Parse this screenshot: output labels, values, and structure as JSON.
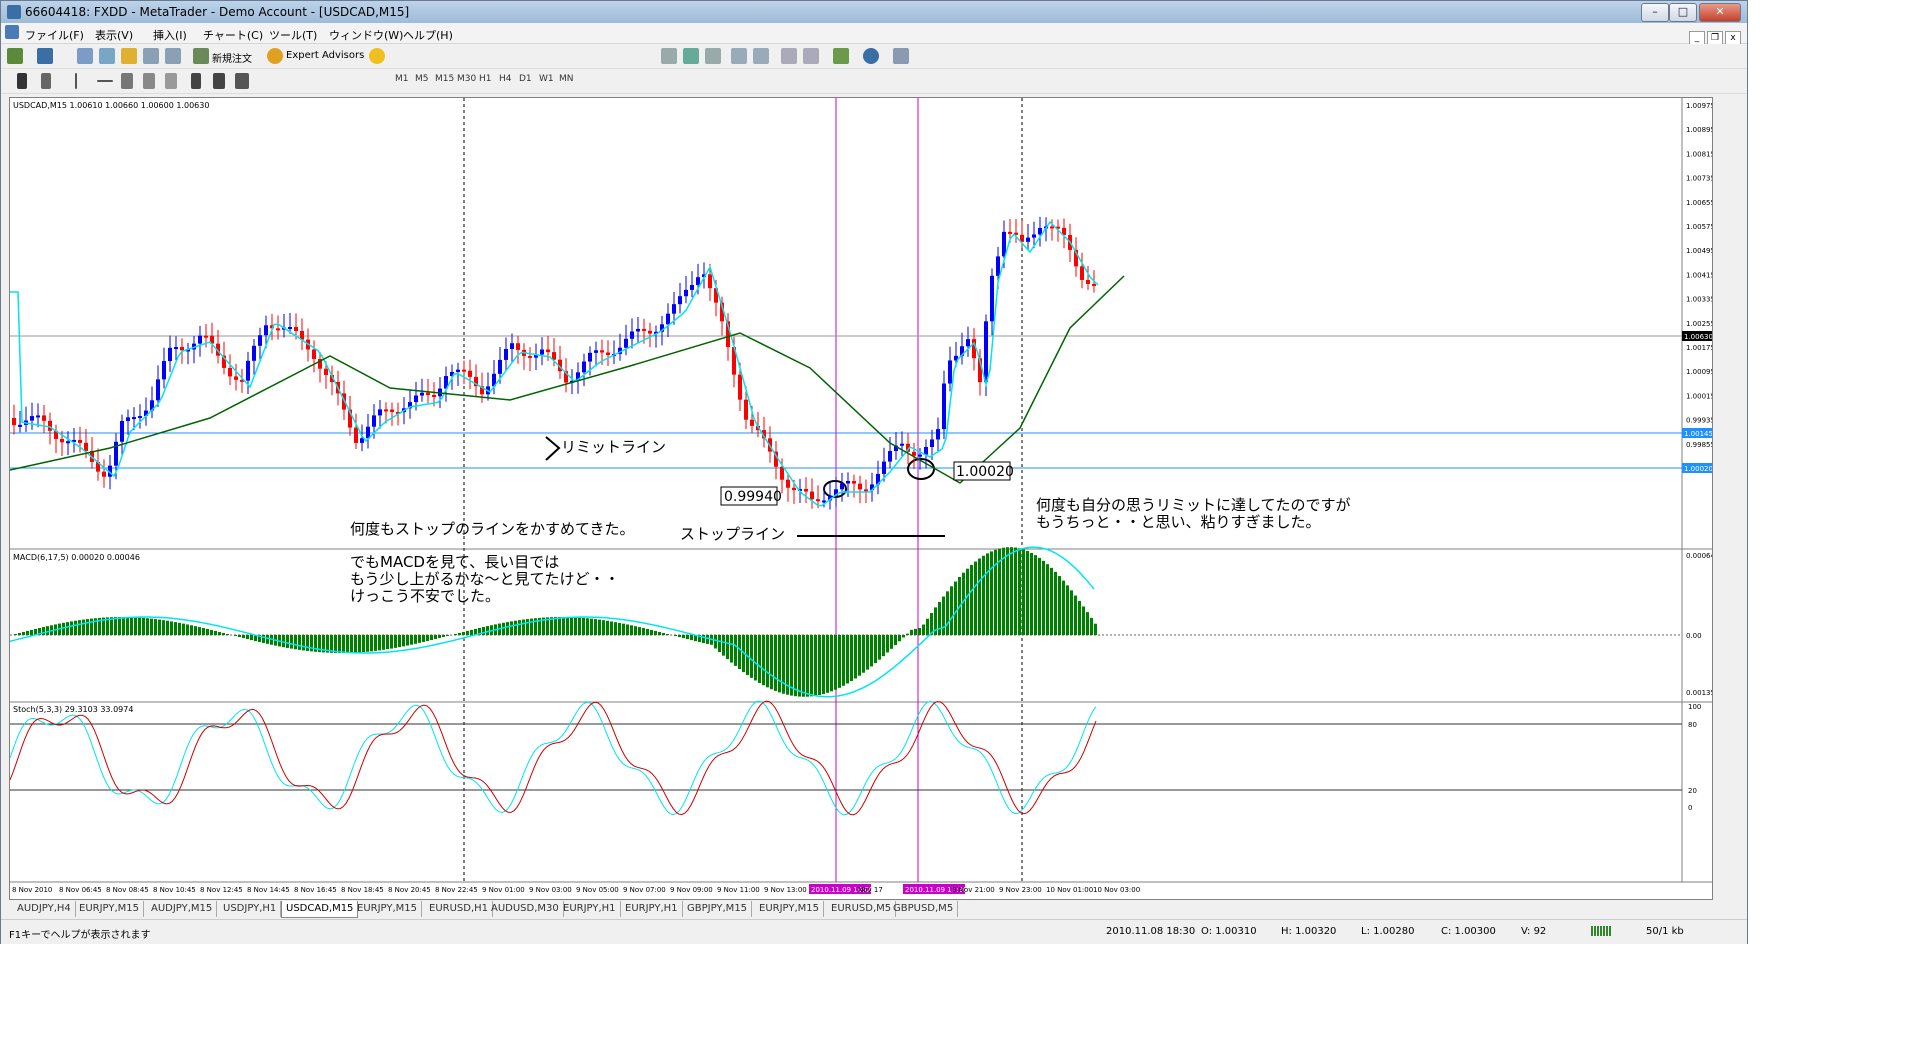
{
  "window": {
    "title": "66604418: FXDD - MetaTrader - Demo Account - [USDCAD,M15]",
    "controls": {
      "minimize": "–",
      "maximize": "□",
      "close": "✕"
    }
  },
  "menu": [
    "ファイル(F)",
    "表示(V)",
    "挿入(I)",
    "チャート(C)",
    "ツール(T)",
    "ウィンドウ(W)",
    "ヘルプ(H)"
  ],
  "toolbar": {
    "new_order": "新規注文",
    "expert_advisors": "Expert Advisors",
    "timeframes": [
      "M1",
      "M5",
      "M15",
      "M30",
      "H1",
      "H4",
      "D1",
      "W1",
      "MN"
    ]
  },
  "chart": {
    "main_info": "USDCAD,M15  1.00610 1.00660 1.00600 1.00630",
    "macd_info": "MACD(6,17,5) 0.00020 0.00046",
    "stoch_info": "Stoch(5,3,3) 29.3103 33.0974",
    "price_ticks": [
      "1.00975",
      "1.00895",
      "1.00815",
      "1.00735",
      "1.00655",
      "1.00575",
      "1.00495",
      "1.00415",
      "1.00335",
      "1.00255",
      "1.00175",
      "1.00095",
      "1.00015",
      "0.99935",
      "0.99855",
      "0.99775"
    ],
    "current_price": "1.00630",
    "limit_price": "1.00145",
    "stop_price": "1.00020",
    "macd_ticks": [
      "0.00064",
      "0.00",
      "0.00135"
    ],
    "stoch_ticks": [
      "100",
      "80",
      "20",
      "0"
    ],
    "time_labels": [
      "8 Nov 2010",
      "8 Nov 06:45",
      "8 Nov 08:45",
      "8 Nov 10:45",
      "8 Nov 12:45",
      "8 Nov 14:45",
      "8 Nov 16:45",
      "8 Nov 18:45",
      "8 Nov 20:45",
      "8 Nov 22:45",
      "9 Nov 01:00",
      "9 Nov 03:00",
      "9 Nov 05:00",
      "9 Nov 07:00",
      "9 Nov 09:00",
      "9 Nov 11:00",
      "9 Nov 13:00",
      "2010.11.09 16:00",
      "Nov 17",
      "2010.11.09 19:30",
      "9 Nov 21:00",
      "9 Nov 23:00",
      "10 Nov 01:00",
      "10 Nov 03:00"
    ],
    "annotations": {
      "limit_line": "リミットライン",
      "box_low": "0.99940",
      "box_stop": "1.00020",
      "stop_line": "ストップライン",
      "note_stop": "何度もストップのラインをかすめてきた。",
      "note_macd": [
        "でもMACDを見て、長い目では",
        "もう少し上がるかな～と見てたけど・・",
        "けっこう不安でした。"
      ],
      "note_right": [
        "何度も自分の思うリミットに達してたのですが",
        "もうちっと・・と思い、粘りすぎました。"
      ]
    }
  },
  "tabs": [
    "AUDJPY,H4",
    "EURJPY,M15",
    "AUDJPY,M15",
    "USDJPY,H1",
    "USDCAD,M15",
    "EURJPY,M15",
    "EURUSD,H1",
    "AUDUSD,M30",
    "EURJPY,H1",
    "EURJPY,H1",
    "GBPJPY,M15",
    "EURJPY,M15",
    "EURUSD,M5",
    "GBPUSD,M5"
  ],
  "active_tab": 4,
  "status": {
    "help": "F1キーでヘルプが表示されます",
    "datetime": "2010.11.08 18:30",
    "open": "O: 1.00310",
    "high": "H: 1.00320",
    "low": "L: 1.00280",
    "close": "C: 1.00300",
    "volume": "V: 92",
    "traffic": "50/1 kb"
  },
  "colors": {
    "bull_candle": "#0000ff",
    "bear_candle": "#ff0000",
    "fast_ma": "#00e5ee",
    "slow_ma": "#006400",
    "macd_hist": "#008000",
    "macd_signal": "#00e5ee",
    "stoch_main": "#00e5ee",
    "stoch_signal": "#cc0000",
    "hline": "#1e90ff",
    "vline": "#cc00cc"
  }
}
